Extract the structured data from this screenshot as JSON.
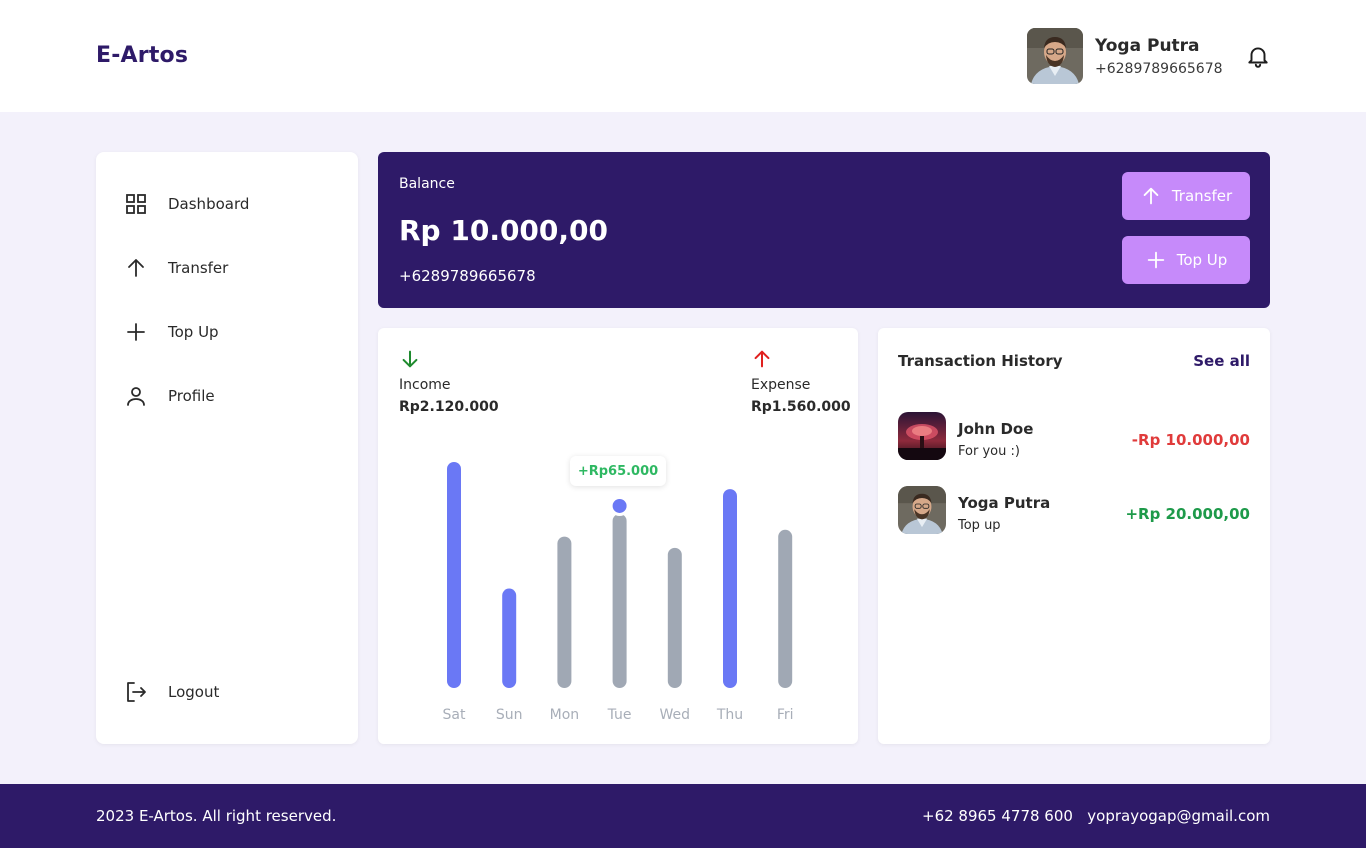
{
  "header": {
    "brand": "E-Artos",
    "user": {
      "name": "Yoga Putra",
      "phone": "+6289789665678"
    },
    "icons": {
      "avatar": "user-avatar-photo",
      "notification": "bell-icon"
    }
  },
  "sidebar": {
    "items": [
      {
        "label": "Dashboard",
        "icon": "grid-icon"
      },
      {
        "label": "Transfer",
        "icon": "arrow-up-icon"
      },
      {
        "label": "Top Up",
        "icon": "plus-icon"
      },
      {
        "label": "Profile",
        "icon": "user-icon"
      }
    ],
    "logout": {
      "label": "Logout",
      "icon": "logout-icon"
    }
  },
  "balance": {
    "label": "Balance",
    "amount": "Rp 10.000,00",
    "phone": "+6289789665678",
    "buttons": {
      "transfer": "Transfer",
      "topup": "Top Up"
    }
  },
  "summary": {
    "income": {
      "label": "Income",
      "value": "Rp2.120.000",
      "color": "#1E8A2E"
    },
    "expense": {
      "label": "Expense",
      "value": "Rp1.560.000",
      "color": "#E0201E"
    }
  },
  "chart_data": {
    "type": "bar",
    "categories": [
      "Sat",
      "Sun",
      "Mon",
      "Tue",
      "Wed",
      "Thu",
      "Fri"
    ],
    "values": [
      100,
      44,
      67,
      77,
      62,
      88,
      70
    ],
    "ylim": [
      0,
      100
    ],
    "bar_colors": [
      "#6A78F5",
      "#6A78F5",
      "#A0A8B4",
      "#A0A8B4",
      "#A0A8B4",
      "#6A78F5",
      "#A0A8B4"
    ],
    "highlight": {
      "category": "Tue",
      "label": "+Rp65.000"
    },
    "grid": false
  },
  "transactions": {
    "title": "Transaction History",
    "see_all": "See all",
    "items": [
      {
        "name": "John Doe",
        "note": "For you :)",
        "amount": "-Rp 10.000,00",
        "color": "#E03B3B"
      },
      {
        "name": "Yoga Putra",
        "note": "Top up",
        "amount": "+Rp 20.000,00",
        "color": "#1E9A4A"
      }
    ]
  },
  "footer": {
    "copyright": "2023 E-Artos. All right reserved.",
    "phone": "+62 8965 4778 600",
    "email": "yoprayogap@gmail.com"
  },
  "colors": {
    "primary": "#2E1A68",
    "accent": "#C68AFA",
    "background": "#F3F1FB"
  }
}
